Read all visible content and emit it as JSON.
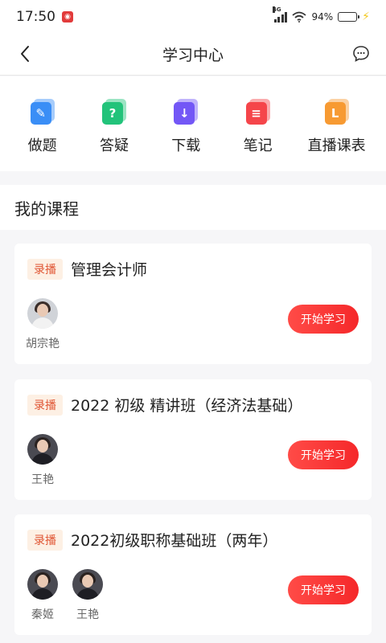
{
  "status_bar": {
    "time": "17:50",
    "network": "4G",
    "battery": "94%",
    "battery_level": 0.94
  },
  "nav": {
    "title": "学习中心"
  },
  "quick_actions": [
    {
      "label": "做题",
      "icon": "pencil-icon",
      "color": "#3a8ef6",
      "glyph": "✎"
    },
    {
      "label": "答疑",
      "icon": "question-icon",
      "color": "#22c37a",
      "glyph": "?"
    },
    {
      "label": "下载",
      "icon": "download-icon",
      "color": "#7357f6",
      "glyph": "↓"
    },
    {
      "label": "笔记",
      "icon": "note-icon",
      "color": "#f5454a",
      "glyph": "≡"
    },
    {
      "label": "直播课表",
      "icon": "schedule-icon",
      "color": "#f79a32",
      "glyph": "L"
    }
  ],
  "section": {
    "title": "我的课程"
  },
  "courses": [
    {
      "tag": "录播",
      "title": "管理会计师",
      "teachers": [
        "胡宗艳"
      ],
      "button": "开始学习"
    },
    {
      "tag": "录播",
      "title": "2022 初级 精讲班（经济法基础）",
      "teachers": [
        "王艳"
      ],
      "button": "开始学习"
    },
    {
      "tag": "录播",
      "title": "2022初级职称基础班（两年）",
      "teachers": [
        "秦姬",
        "王艳"
      ],
      "button": "开始学习"
    }
  ],
  "colors": {
    "accent": "#f5282a",
    "tag_bg": "#fdf0e4",
    "tag_text": "#e05533"
  }
}
